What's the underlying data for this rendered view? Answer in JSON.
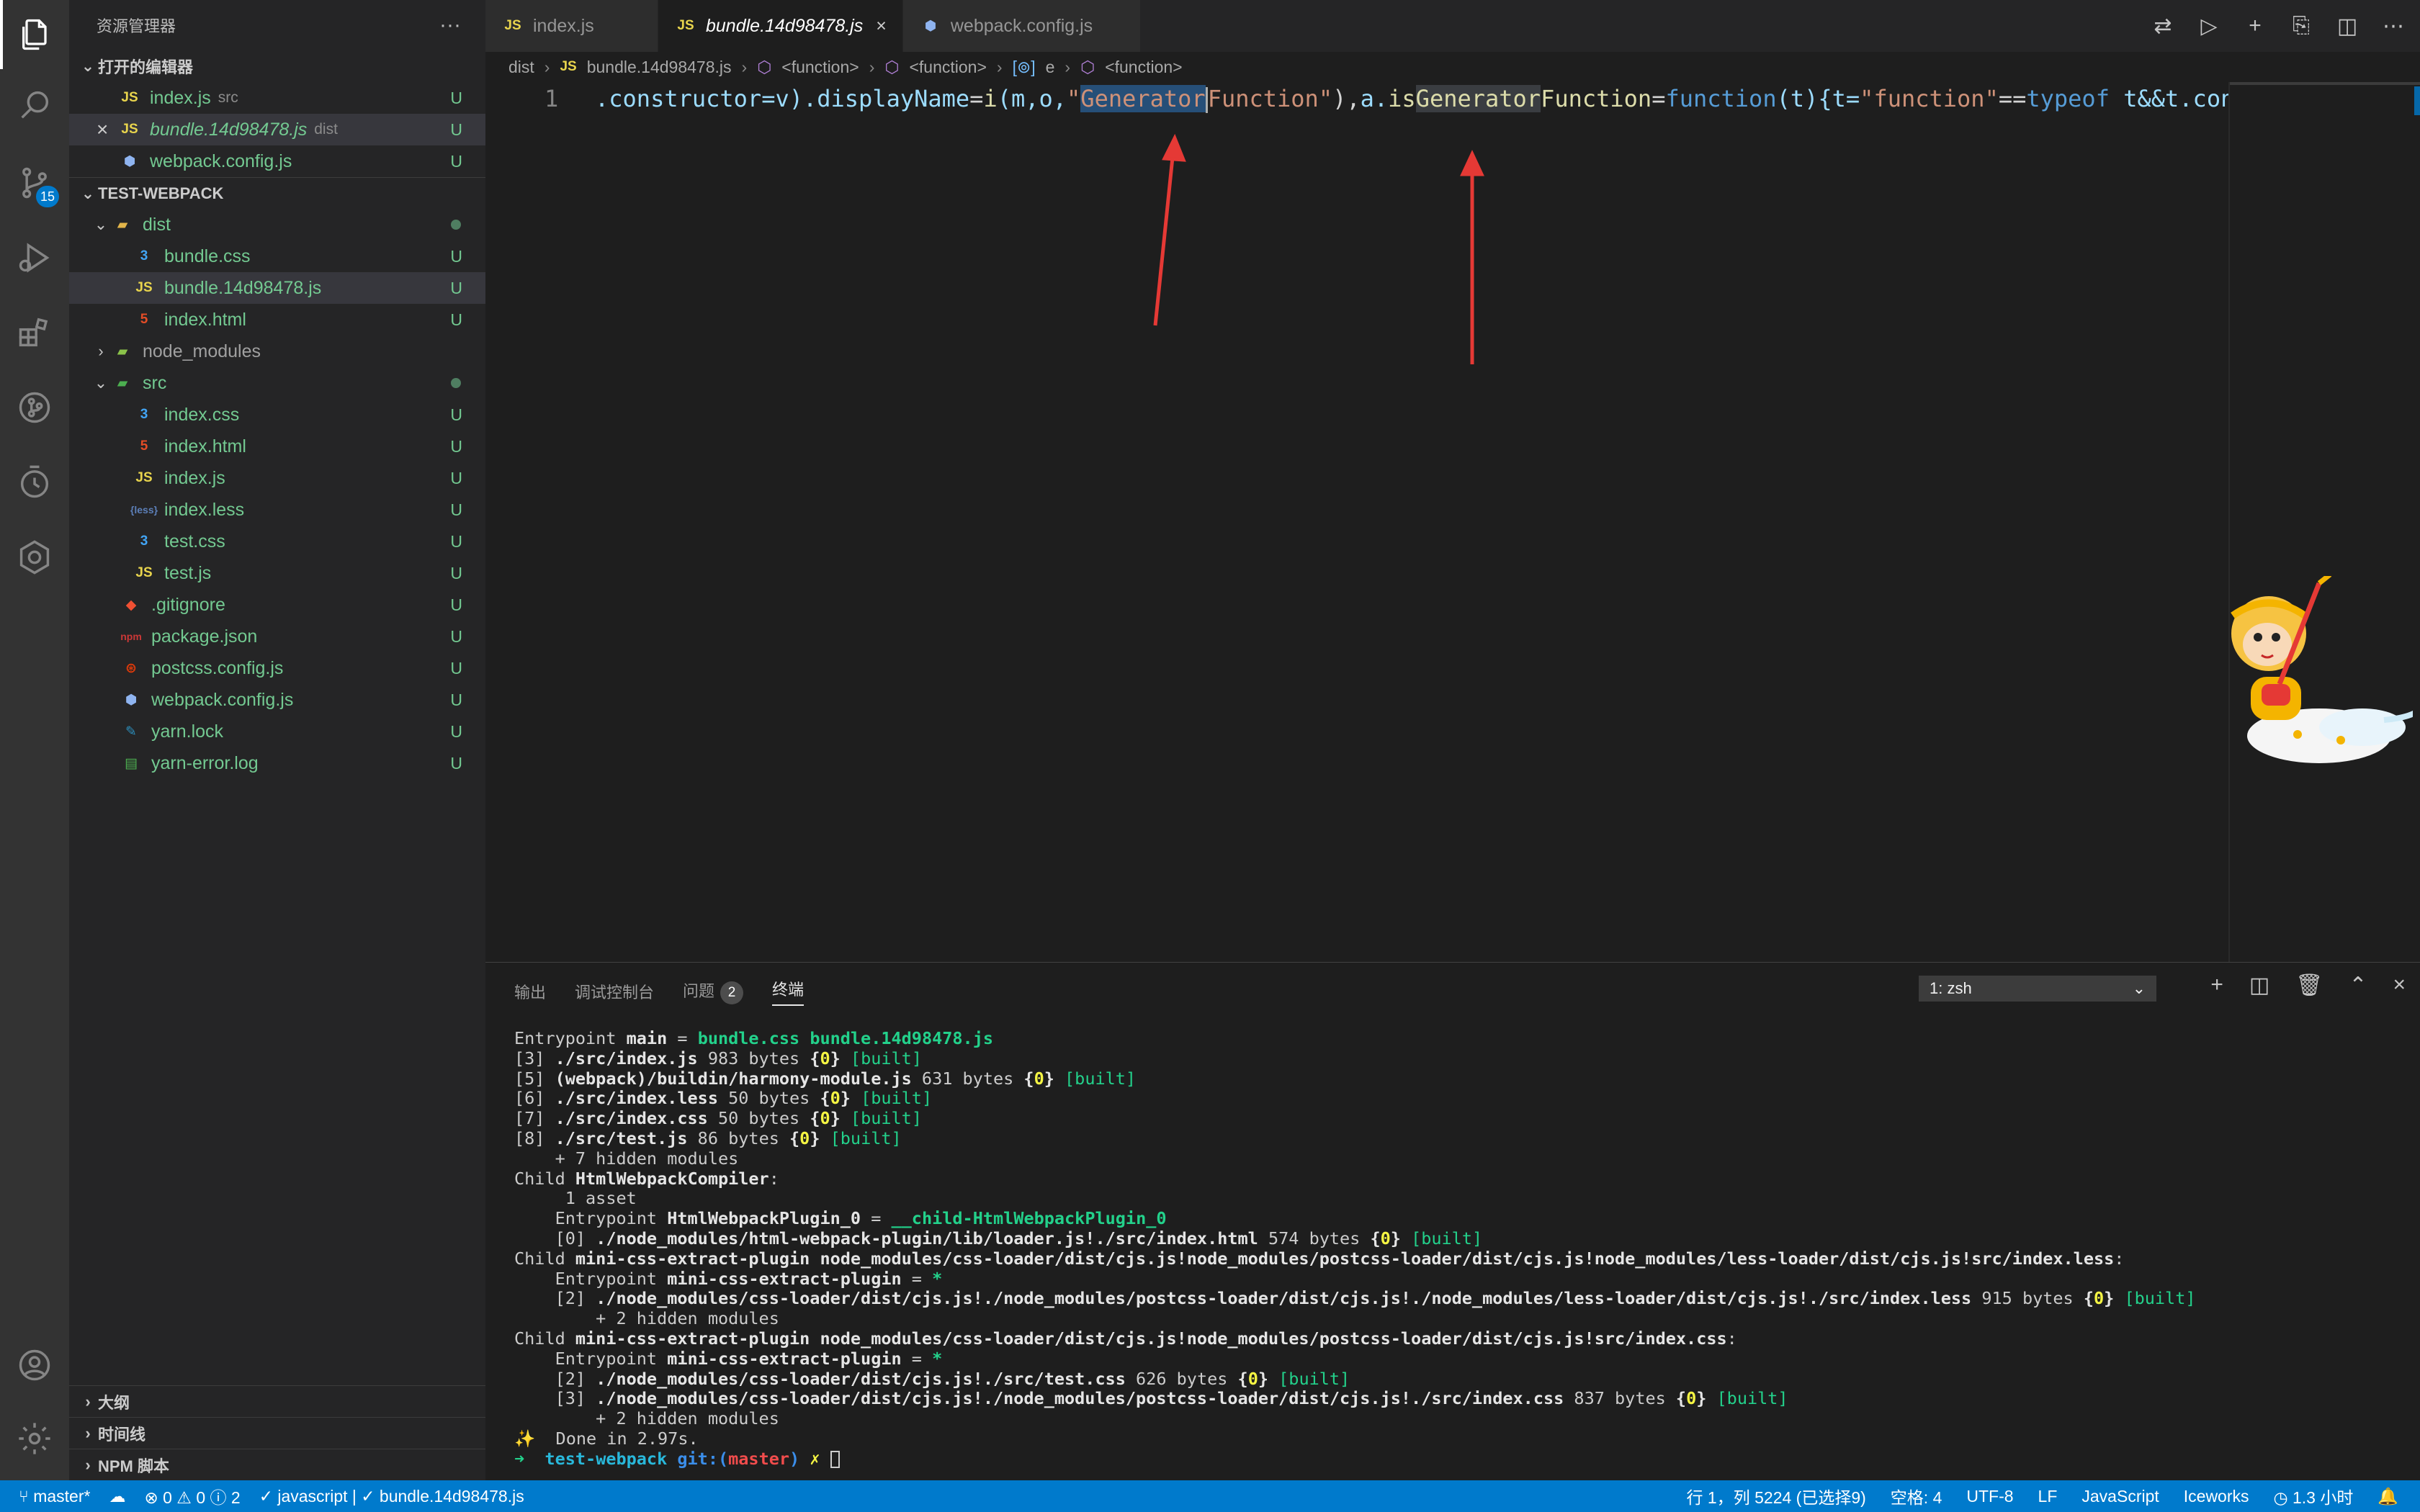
{
  "sidebar": {
    "title": "资源管理器",
    "more": "···",
    "open_editors_title": "打开的编辑器",
    "open_editors": [
      {
        "icon": "JS",
        "name": "index.js",
        "desc": "src",
        "status": "U"
      },
      {
        "icon": "JS",
        "name": "bundle.14d98478.js",
        "desc": "dist",
        "status": "U",
        "close": "×"
      },
      {
        "icon": "cfg",
        "name": "webpack.config.js",
        "desc": "",
        "status": "U"
      }
    ],
    "project_title": "TEST-WEBPACK",
    "tree": [
      {
        "name": "dist",
        "status": "dot"
      },
      {
        "name": "bundle.css",
        "status": "U"
      },
      {
        "name": "bundle.14d98478.js",
        "status": "U"
      },
      {
        "name": "index.html",
        "status": "U"
      },
      {
        "name": "node_modules",
        "status": ""
      },
      {
        "name": "src",
        "status": "dot"
      },
      {
        "name": "index.css",
        "status": "U"
      },
      {
        "name": "index.html",
        "status": "U"
      },
      {
        "name": "index.js",
        "status": "U"
      },
      {
        "name": "index.less",
        "status": "U"
      },
      {
        "name": "test.css",
        "status": "U"
      },
      {
        "name": "test.js",
        "status": "U"
      },
      {
        "name": ".gitignore",
        "status": "U"
      },
      {
        "name": "package.json",
        "status": "U"
      },
      {
        "name": "postcss.config.js",
        "status": "U"
      },
      {
        "name": "webpack.config.js",
        "status": "U"
      },
      {
        "name": "yarn.lock",
        "status": "U"
      },
      {
        "name": "yarn-error.log",
        "status": "U"
      }
    ],
    "outline": "大纲",
    "timeline": "时间线",
    "npm": "NPM 脚本"
  },
  "activity": {
    "scm_badge": "15"
  },
  "tabs": [
    {
      "icon": "JS",
      "label": "index.js"
    },
    {
      "icon": "JS",
      "label": "bundle.14d98478.js",
      "close": "×"
    },
    {
      "icon": "cfg",
      "label": "webpack.config.js"
    }
  ],
  "breadcrumb": {
    "folder": "dist",
    "file": "bundle.14d98478.js",
    "sym1": "<function>",
    "sym2": "<function>",
    "sym3": "e",
    "sym4": "<function>"
  },
  "editor": {
    "line_number": "1",
    "code": {
      "p1": ".constructor=v).",
      "p2": "displayName",
      "p3": "=",
      "p4": "i",
      "p5": "(m,o,",
      "s1": "\"",
      "s2": "Generator",
      "s3": "Function\"",
      "p6": "),",
      "p7": "a.",
      "p8": "is",
      "p9": "Generator",
      "p10": "Function",
      "p11": "=",
      "p12": "function",
      "p13": "(t){t=",
      "s4": "\"function\"",
      "p14": "==",
      "p15": "typeof",
      "p16": " t&&t.con"
    }
  },
  "panel": {
    "tabs": {
      "output": "输出",
      "debug": "调试控制台",
      "problems": "问题",
      "problems_count": "2",
      "terminal": "终端"
    },
    "terminal_select": "1: zsh"
  },
  "terminal": {
    "l1a": "Entrypoint ",
    "l1b": "main",
    "l1c": " = ",
    "l1d": "bundle.css bundle.14d98478.js",
    "l2a": "[3] ",
    "l2b": "./src/index.js",
    "l2c": " 983 bytes ",
    "l2d": "{",
    "l2e": "0",
    "l2f": "}",
    "l2g": " [built]",
    "l3a": "[5] ",
    "l3b": "(webpack)/buildin/harmony-module.js",
    "l3c": " 631 bytes ",
    "l3e": "0",
    "l3g": " [built]",
    "l4a": "[6] ",
    "l4b": "./src/index.less",
    "l4c": " 50 bytes ",
    "l4e": "0",
    "l4g": " [built]",
    "l5a": "[7] ",
    "l5b": "./src/index.css",
    "l5c": " 50 bytes ",
    "l5e": "0",
    "l5g": " [built]",
    "l6a": "[8] ",
    "l6b": "./src/test.js",
    "l6c": " 86 bytes ",
    "l6e": "0",
    "l6g": " [built]",
    "l7": "    + 7 hidden modules",
    "l8a": "Child ",
    "l8b": "HtmlWebpackCompiler",
    "l8c": ":",
    "l9": "     1 asset",
    "l10a": "    Entrypoint ",
    "l10b": "HtmlWebpackPlugin_0",
    "l10c": " = ",
    "l10d": "__child-HtmlWebpackPlugin_0",
    "l11a": "    [0] ",
    "l11b": "./node_modules/html-webpack-plugin/lib/loader.js!./src/index.html",
    "l11c": " 574 bytes ",
    "l11e": "0",
    "l11g": " [built]",
    "l12a": "Child ",
    "l12b": "mini-css-extract-plugin node_modules/css-loader/dist/cjs.js!node_modules/postcss-loader/dist/cjs.js!node_modules/less-loader/dist/cjs.js!src/index.less",
    "l12c": ":",
    "l13a": "    Entrypoint ",
    "l13b": "mini-css-extract-plugin",
    "l13c": " = ",
    "l13d": "*",
    "l14a": "    [2] ",
    "l14b": "./node_modules/css-loader/dist/cjs.js!./node_modules/postcss-loader/dist/cjs.js!./node_modules/less-loader/dist/cjs.js!./src/index.less",
    "l14c": " 915 bytes ",
    "l14e": "0",
    "l14g": " [built]",
    "l15": "        + 2 hidden modules",
    "l16a": "Child ",
    "l16b": "mini-css-extract-plugin node_modules/css-loader/dist/cjs.js!node_modules/postcss-loader/dist/cjs.js!src/index.css",
    "l16c": ":",
    "l17a": "    Entrypoint ",
    "l17b": "mini-css-extract-plugin",
    "l17c": " = ",
    "l17d": "*",
    "l18a": "    [2] ",
    "l18b": "./node_modules/css-loader/dist/cjs.js!./src/test.css",
    "l18c": " 626 bytes ",
    "l18e": "0",
    "l18g": " [built]",
    "l19a": "    [3] ",
    "l19b": "./node_modules/css-loader/dist/cjs.js!./node_modules/postcss-loader/dist/cjs.js!./src/index.css",
    "l19c": " 837 bytes ",
    "l19e": "0",
    "l19g": " [built]",
    "l20": "        + 2 hidden modules",
    "l21": "✨  Done in 2.97s.",
    "p_arrow": "➜  ",
    "p_dir": "test-webpack",
    "p_git": " git:(",
    "p_branch": "master",
    "p_close": ")",
    "p_x": " ✗ "
  },
  "status": {
    "branch": "master*",
    "errors": "0",
    "warnings": "0",
    "infos": "2",
    "lang_check": "✓ javascript | ✓ bundle.14d98478.js",
    "position": "行 1，列 5224 (已选择9)",
    "spaces": "空格: 4",
    "encoding": "UTF-8",
    "eol": "LF",
    "language": "JavaScript",
    "iceworks": "Iceworks",
    "time": "1.3 小时"
  }
}
